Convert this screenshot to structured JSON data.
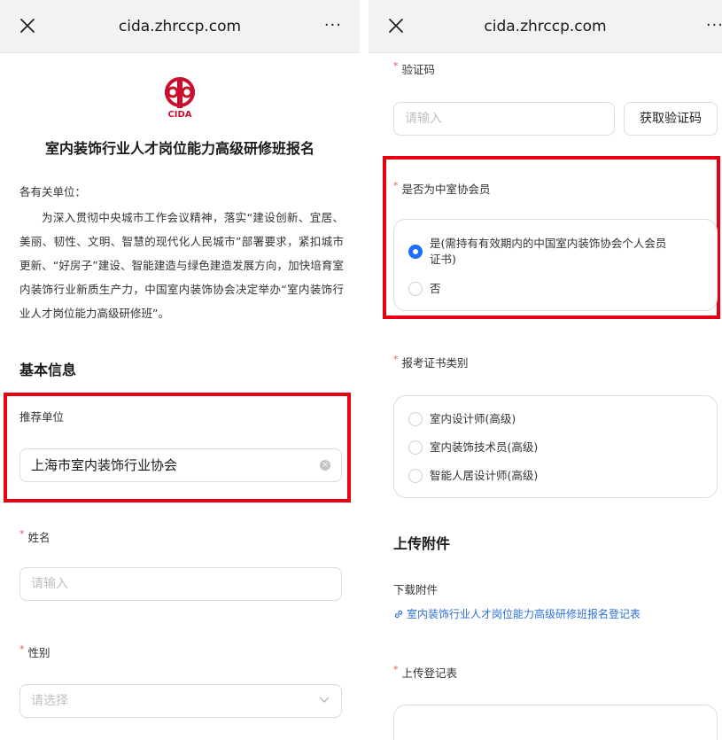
{
  "browser": {
    "url_title": "cida.zhrccp.com",
    "more_label": "···"
  },
  "colors": {
    "highlight": "#e60012",
    "accent": "#1a6dff",
    "link": "#2f6fd6",
    "required": "#ee5555",
    "logo": "#c8102e"
  },
  "icons": {
    "close": "close-icon",
    "more": "more-icon",
    "logo": "cida-logo",
    "clear": "clear-icon",
    "chevron": "chevron-down-icon",
    "link": "link-icon"
  },
  "left": {
    "logo_text": "CIDA",
    "title": "室内装饰行业人才岗位能力高级研修班报名",
    "greeting": "各有关单位：",
    "body": "为深入贯彻中央城市工作会议精神，落实“建设创新、宜居、美丽、韧性、文明、智慧的现代化人民城市”部署要求，紧扣城市更新、“好房子”建设、智能建造与绿色建造发展方向，加快培育室内装饰行业新质生产力，中国室内装饰协会决定举办“室内装饰行业人才岗位能力高级研修班”。",
    "section_basic": "基本信息",
    "recommend_label": "推荐单位",
    "recommend_value": "上海市室内装饰行业协会",
    "name_label": "姓名",
    "name_placeholder": "请输入",
    "gender_label": "性别",
    "gender_placeholder": "请选择",
    "required_mark": "*"
  },
  "right": {
    "code_label": "验证码",
    "code_placeholder": "请输入",
    "get_code_button": "获取验证码",
    "member_label": "是否为中室协会员",
    "member_options": [
      {
        "label_line1": "是(需持有有效期内的中国室内装饰协会个人会员",
        "label_line2": "证书)",
        "checked": true
      },
      {
        "label_line1": "否",
        "label_line2": "",
        "checked": false
      }
    ],
    "cert_label": "报考证书类别",
    "cert_options": [
      "室内设计师(高级)",
      "室内装饰技术员(高级)",
      "智能人居设计师(高级)"
    ],
    "section_upload": "上传附件",
    "download_label": "下载附件",
    "download_link": "室内装饰行业人才岗位能力高级研修班报名登记表",
    "upload_label": "上传登记表",
    "required_mark": "*"
  }
}
